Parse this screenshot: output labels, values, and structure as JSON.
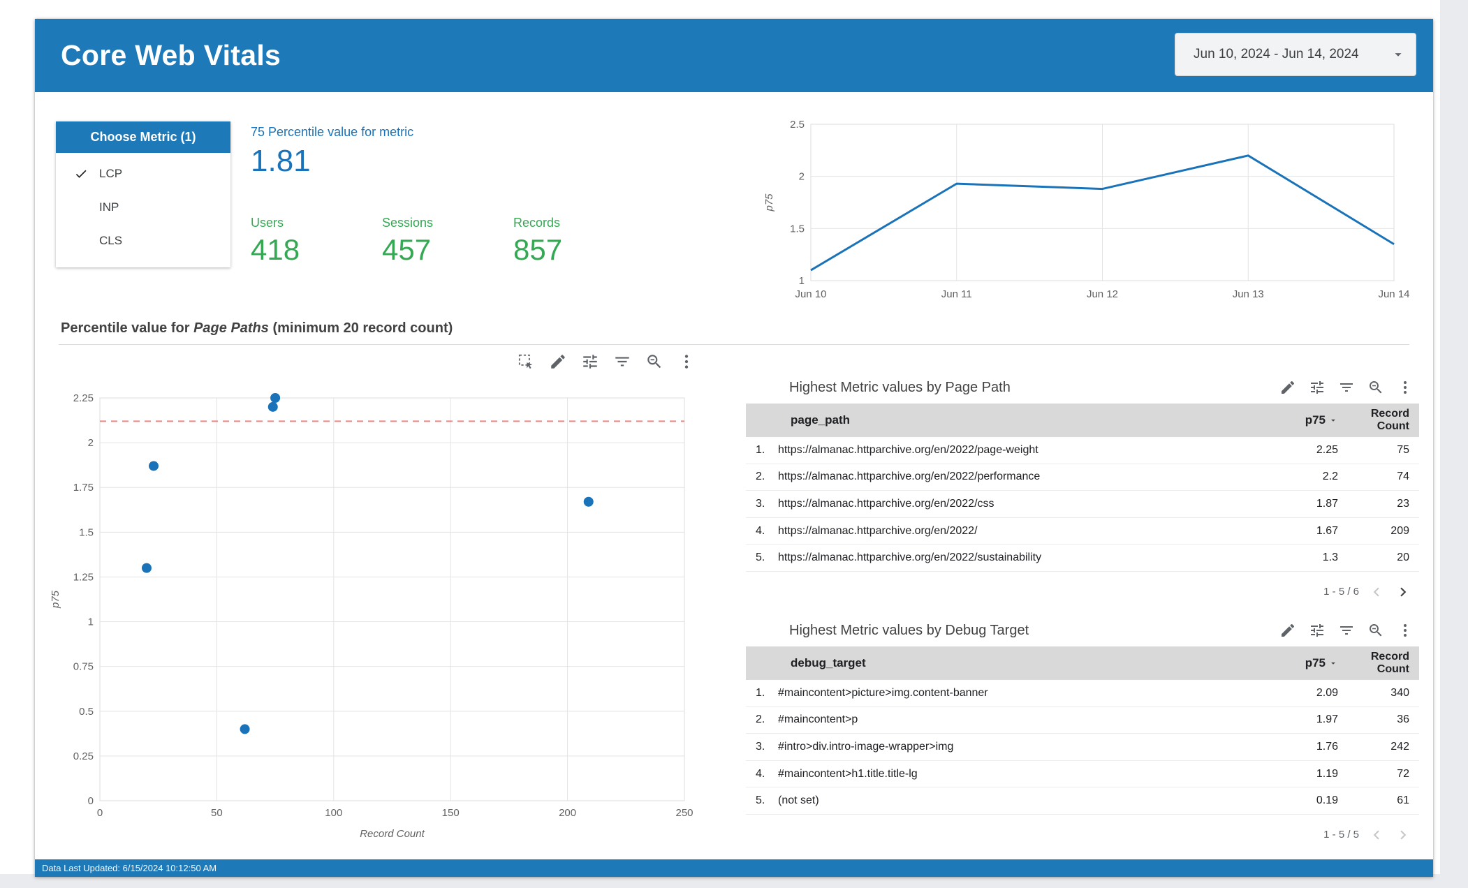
{
  "colors": {
    "header_blue": "#1d79b8",
    "accent_blue": "#1a73b8",
    "green": "#34a853",
    "reference_red": "#f4837d",
    "table_header_gray": "#d9d9d9"
  },
  "header": {
    "title": "Core Web Vitals",
    "date_range": "Jun 10, 2024 - Jun 14, 2024"
  },
  "metric_filter": {
    "header": "Choose Metric (1)",
    "options": [
      {
        "label": "LCP",
        "selected": true
      },
      {
        "label": "INP",
        "selected": false
      },
      {
        "label": "CLS",
        "selected": false
      }
    ]
  },
  "scorecards": {
    "percentile": {
      "label": "75 Percentile value for metric",
      "value": "1.81"
    },
    "users": {
      "label": "Users",
      "value": "418"
    },
    "sessions": {
      "label": "Sessions",
      "value": "457"
    },
    "records": {
      "label": "Records",
      "value": "857"
    }
  },
  "section_title": {
    "prefix": "Percentile value for ",
    "italic": "Page Paths",
    "suffix": " (minimum 20 record count)"
  },
  "chart_data": [
    {
      "type": "line",
      "x": [
        "Jun 10",
        "Jun 11",
        "Jun 12",
        "Jun 13",
        "Jun 14"
      ],
      "series": [
        {
          "name": "p75",
          "values": [
            1.1,
            1.93,
            1.88,
            2.2,
            1.35
          ]
        }
      ],
      "ylabel": "p75",
      "ylim": [
        1,
        2.5
      ],
      "yticks": [
        1,
        1.5,
        2,
        2.5
      ],
      "grid": true,
      "legend": "none",
      "color": "#1a73b8"
    },
    {
      "type": "scatter",
      "points": [
        {
          "x": 20,
          "y": 1.3
        },
        {
          "x": 23,
          "y": 1.87
        },
        {
          "x": 62,
          "y": 0.4
        },
        {
          "x": 74,
          "y": 2.2
        },
        {
          "x": 75,
          "y": 2.25
        },
        {
          "x": 209,
          "y": 1.67
        }
      ],
      "xlabel": "Record Count",
      "ylabel": "p75",
      "xlim": [
        0,
        250
      ],
      "xticks": [
        0,
        50,
        100,
        150,
        200,
        250
      ],
      "ylim": [
        0,
        2.25
      ],
      "yticks": [
        0,
        0.25,
        0.5,
        0.75,
        1,
        1.25,
        1.5,
        1.75,
        2,
        2.25
      ],
      "grid": true,
      "color": "#1a73b8",
      "reference_line": {
        "y": 2.12,
        "color": "#f4837d",
        "style": "dashed"
      }
    }
  ],
  "tables": [
    {
      "title": "Highest Metric values by Page Path",
      "columns": [
        "page_path",
        "p75",
        "Record Count"
      ],
      "rows": [
        {
          "n": "1.",
          "label": "https://almanac.httparchive.org/en/2022/page-weight",
          "p75": "2.25",
          "count": "75"
        },
        {
          "n": "2.",
          "label": "https://almanac.httparchive.org/en/2022/performance",
          "p75": "2.2",
          "count": "74"
        },
        {
          "n": "3.",
          "label": "https://almanac.httparchive.org/en/2022/css",
          "p75": "1.87",
          "count": "23"
        },
        {
          "n": "4.",
          "label": "https://almanac.httparchive.org/en/2022/",
          "p75": "1.67",
          "count": "209"
        },
        {
          "n": "5.",
          "label": "https://almanac.httparchive.org/en/2022/sustainability",
          "p75": "1.3",
          "count": "20"
        }
      ],
      "pagination": "1 - 5 / 6",
      "prev_enabled": false,
      "next_enabled": true
    },
    {
      "title": "Highest Metric values by Debug Target",
      "columns": [
        "debug_target",
        "p75",
        "Record Count"
      ],
      "rows": [
        {
          "n": "1.",
          "label": "#maincontent>picture>img.content-banner",
          "p75": "2.09",
          "count": "340"
        },
        {
          "n": "2.",
          "label": "#maincontent>p",
          "p75": "1.97",
          "count": "36"
        },
        {
          "n": "3.",
          "label": "#intro>div.intro-image-wrapper>img",
          "p75": "1.76",
          "count": "242"
        },
        {
          "n": "4.",
          "label": "#maincontent>h1.title.title-lg",
          "p75": "1.19",
          "count": "72"
        },
        {
          "n": "5.",
          "label": "(not set)",
          "p75": "0.19",
          "count": "61"
        }
      ],
      "pagination": "1 - 5 / 5",
      "prev_enabled": false,
      "next_enabled": false
    }
  ],
  "footer": {
    "text": "Data Last Updated: 6/15/2024 10:12:50 AM"
  },
  "icons": {
    "dropdown-caret": "triangle-down",
    "checkmark": "check",
    "marquee-select": "dashed-box-cursor",
    "edit": "pencil",
    "tune": "sliders",
    "filter": "funnel-lines",
    "zoom-out": "magnifier-minus",
    "more-vert": "kebab",
    "sort-caret": "triangle-down",
    "prev": "chevron-left",
    "next": "chevron-right"
  }
}
